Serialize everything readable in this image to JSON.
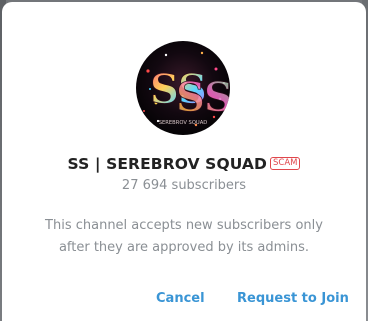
{
  "dialog": {
    "channel_name": "SS | SEREBROV SQUAD",
    "badge": "SCAM",
    "avatar_logo_text": "SS",
    "avatar_caption": "SEREBROV SQUAD",
    "subscribers": "27 694 subscribers",
    "description": "This channel accepts new subscribers only after they are approved by its admins.",
    "cancel_label": "Cancel",
    "request_label": "Request to Join"
  },
  "colors": {
    "accent": "#3a95d5",
    "scam": "#e0474c",
    "title": "#222222",
    "muted": "#8a8f94"
  }
}
